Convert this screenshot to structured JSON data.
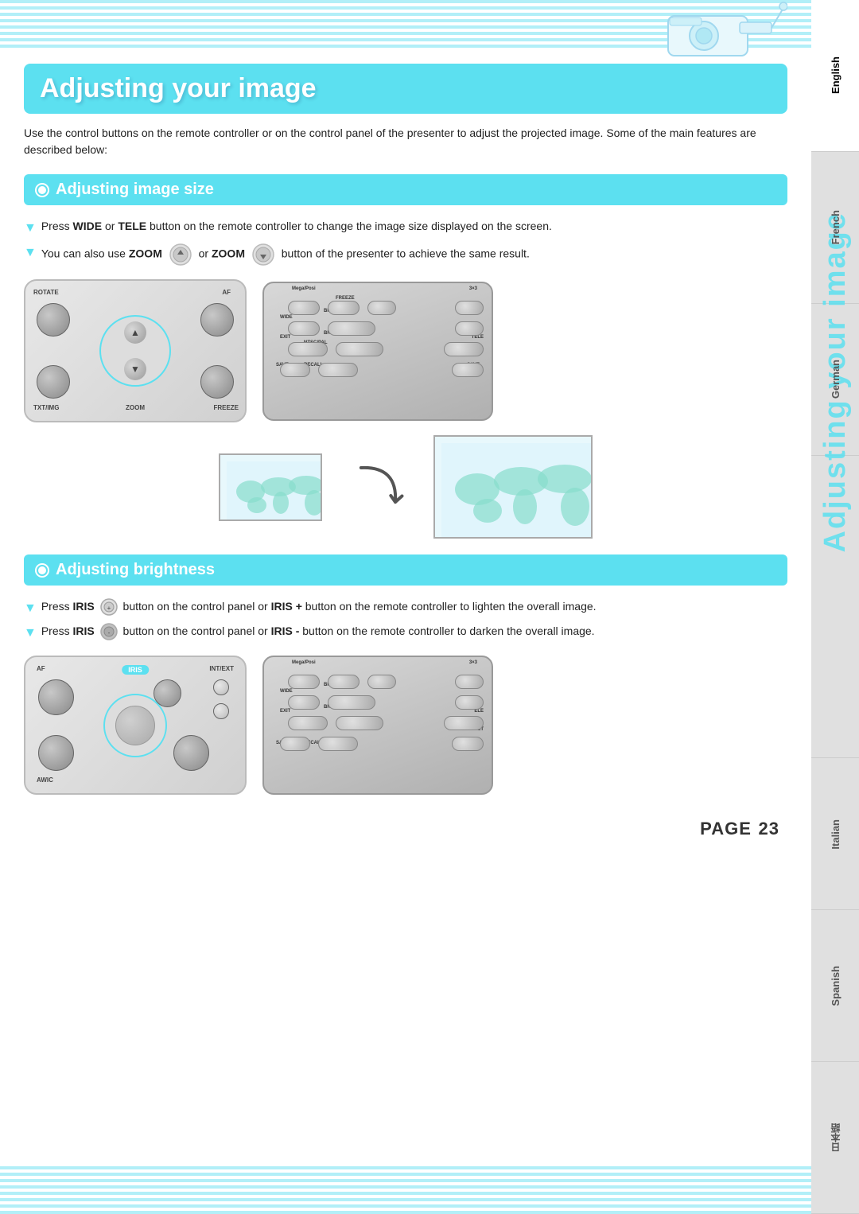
{
  "page": {
    "title": "Adjusting your image",
    "intro": "Use the control buttons on the remote controller or on the control panel of the presenter to adjust the projected image. Some of the main features are described below:",
    "page_label": "PAGE",
    "page_number": "23",
    "sidebar_title": "Adjusting your image"
  },
  "languages": [
    {
      "label": "English",
      "active": true
    },
    {
      "label": "French",
      "active": false
    },
    {
      "label": "German",
      "active": false
    },
    {
      "label": "Italian",
      "active": false
    },
    {
      "label": "Spanish",
      "active": false
    },
    {
      "label": "日本語",
      "active": false
    }
  ],
  "section1": {
    "title": "Adjusting image size",
    "bullet1": "Press WIDE or TELE button on the remote controller to change the image size displayed on the screen.",
    "bullet1_bold": [
      "WIDE",
      "TELE"
    ],
    "bullet2_pre": "You can also use ",
    "bullet2_zoom1": "ZOOM",
    "bullet2_mid": " or ",
    "bullet2_zoom2": "ZOOM",
    "bullet2_post": " button of the presenter to achieve the same result.",
    "control_panel_labels": {
      "rotate": "ROTATE",
      "af": "AF",
      "txt_img": "TXT/IMG",
      "zoom": "ZOOM",
      "freeze": "FREEZE"
    }
  },
  "section2": {
    "title": "Adjusting brightness",
    "bullet1_pre": "Press ",
    "bullet1_iris": "IRIS",
    "bullet1_post": " button on the control panel or IRIS + button on the remote controller to lighten the overall image.",
    "bullet2_pre": "Press ",
    "bullet2_iris": "IRIS",
    "bullet2_post": " button on the control panel or IRIS - button on the remote controller to darken the overall image.",
    "press_iris_1": "Press IRIS",
    "press_iris_2": "Press IRIS",
    "iris_label": "IRIS",
    "af_label": "AF",
    "int_ext_label": "INT/EXT",
    "awic_label": "AWIC"
  }
}
